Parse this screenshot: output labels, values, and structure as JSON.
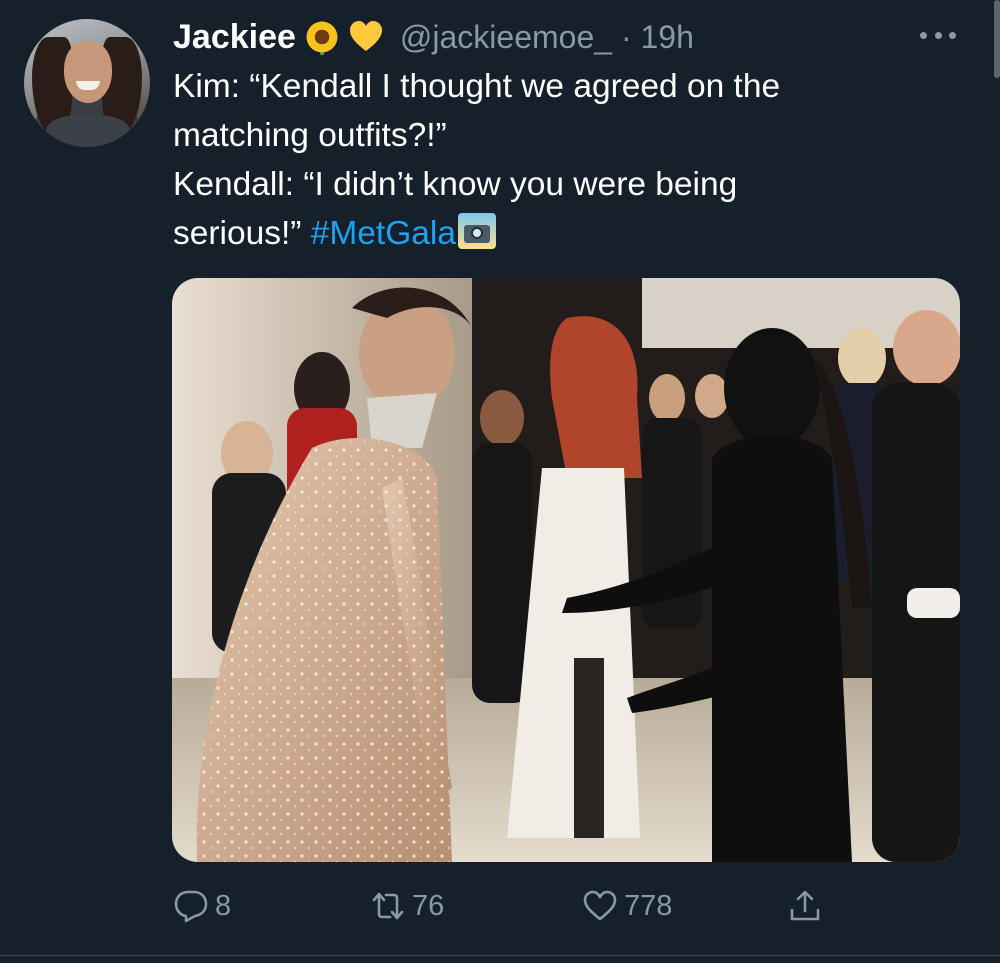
{
  "tweet": {
    "display_name": "Jackiee",
    "handle": "@jackieemoe_",
    "separator": " · ",
    "time": "19h",
    "name_emojis": [
      "sunflower-icon",
      "yellow-heart-icon"
    ],
    "text_lines": [
      "Kim: “Kendall I thought we agreed on the",
      "matching outfits?!”",
      "Kendall: “I didn’t know you were being",
      "serious!” "
    ],
    "hashtag": "#MetGala",
    "trailing_emoji": "camera-flash-icon"
  },
  "actions": {
    "replies": "8",
    "retweets": "76",
    "likes": "778"
  },
  "colors": {
    "background": "#15202b",
    "secondary_text": "#8899a6",
    "link": "#1da1f2"
  }
}
